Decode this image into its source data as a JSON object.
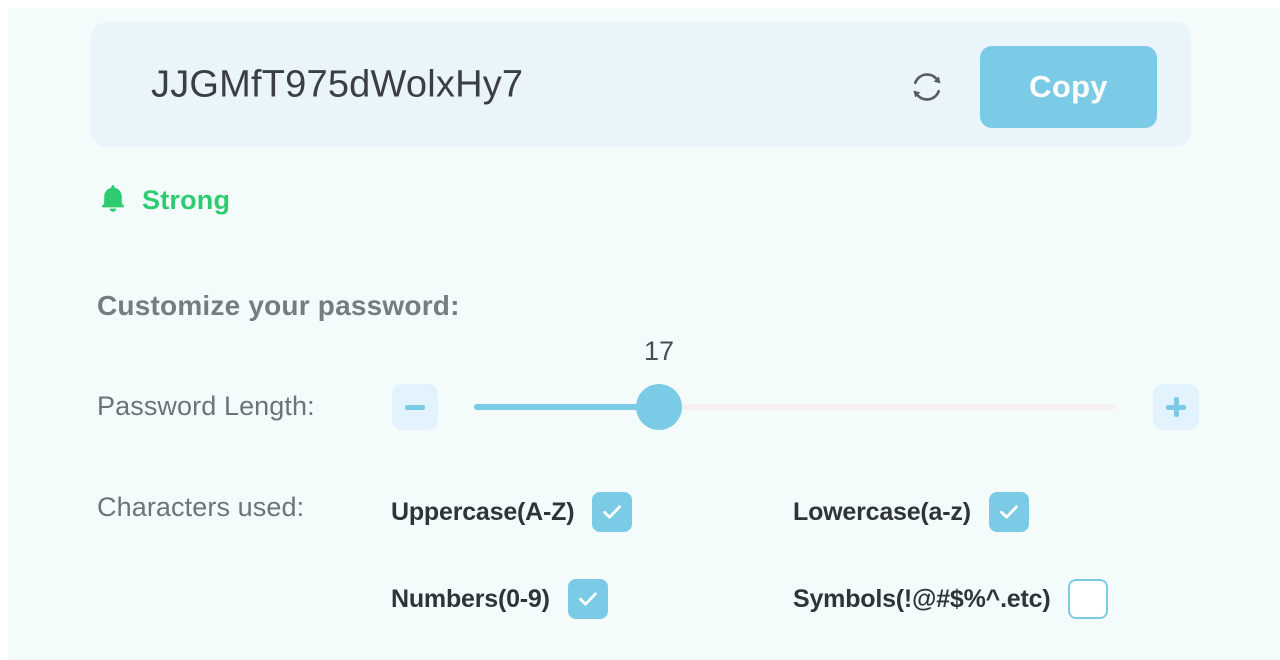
{
  "password_field": {
    "value": "JJGMfT975dWolxHy7",
    "refresh_icon": "refresh-icon",
    "copy_label": "Copy"
  },
  "strength": {
    "icon": "bell-icon",
    "label": "Strong",
    "color": "#2ecb71"
  },
  "customize": {
    "heading": "Customize your password:",
    "length": {
      "label": "Password Length:",
      "value": "17",
      "min_label": "−",
      "max_label": "+",
      "decrement_icon": "minus-icon",
      "increment_icon": "plus-icon",
      "slider_fill_percent": 29
    },
    "characters": {
      "label": "Characters used:",
      "options": [
        {
          "label": "Uppercase(A-Z)",
          "checked": true
        },
        {
          "label": "Lowercase(a-z)",
          "checked": true
        },
        {
          "label": "Numbers(0-9)",
          "checked": true
        },
        {
          "label": "Symbols(!@#$%^.etc)",
          "checked": false
        }
      ]
    }
  },
  "colors": {
    "page_bg": "#f4fcfb",
    "field_bg": "#e9f4fb",
    "accent": "#7ccbe6",
    "strength_green": "#2ecb71",
    "step_btn_bg": "#e3f3fd",
    "track_bg": "#f6f0f1"
  }
}
